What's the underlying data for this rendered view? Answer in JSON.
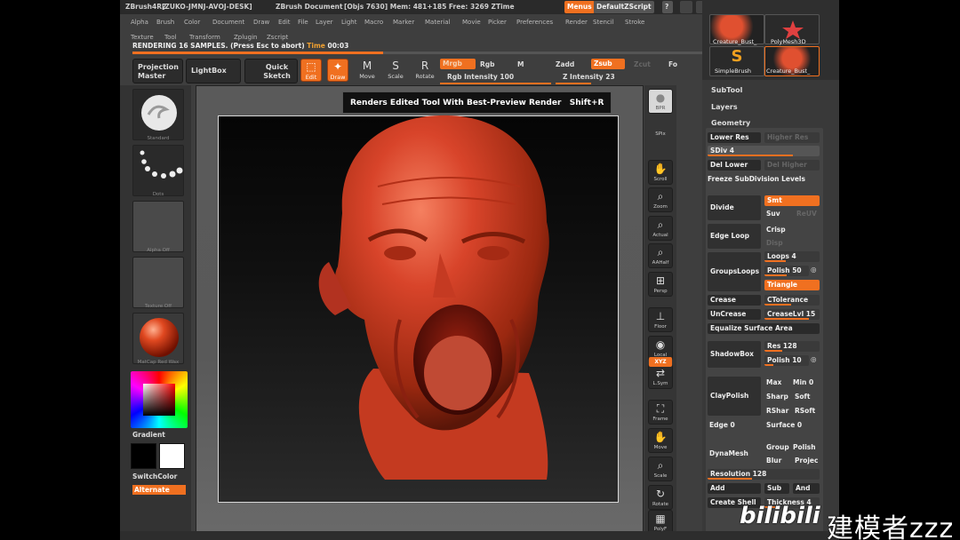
{
  "titlebar": {
    "app": "ZBrush4R2",
    "machine": "[ZUKO-JMNJ-AVOJ-DESK]",
    "document": "ZBrush Document",
    "stats": "[Objs 7630] Mem: 481+185 Free: 3269 ZTime",
    "menus_btn": "Menus",
    "script_btn": "DefaultZScript"
  },
  "menu_row1": [
    "Alpha",
    "Brush",
    "Color",
    "Document",
    "Draw",
    "Edit",
    "File",
    "Layer",
    "Light",
    "Macro",
    "Marker",
    "Material",
    "Movie",
    "Picker",
    "Preferences",
    "Render",
    "Stencil",
    "Stroke"
  ],
  "menu_row2": [
    "Texture",
    "Tool",
    "Transform",
    "Zplugin",
    "Zscript"
  ],
  "status": {
    "text": "RENDERING 16 SAMPLES. (Press Esc to abort)",
    "time_label": "Time",
    "time_value": "00:03",
    "progress": 0.43
  },
  "topshelf": {
    "projection_master": "Projection Master",
    "lightbox": "LightBox",
    "quick_sketch": "Quick Sketch",
    "edit": "Edit",
    "draw": "Draw",
    "move": "Move",
    "scale": "Scale",
    "rotate": "Rotate",
    "mrgb": "Mrgb",
    "rgb": "Rgb",
    "m": "M",
    "rgb_intensity": "Rgb Intensity 100",
    "zadd": "Zadd",
    "zsub": "Zsub",
    "zcut": "Zcut",
    "z_intensity": "Z Intensity 23",
    "focal": "Fo"
  },
  "leftshelf": {
    "brush_label": "Standard",
    "stroke_label": "Dots",
    "alpha_label": "Alpha Off",
    "texture_label": "Texture Off",
    "material_label": "MatCap Red Wax",
    "gradient": "Gradient",
    "switchcolor": "SwitchColor",
    "alternate": "Alternate"
  },
  "tooltip": {
    "text": "Renders Edited Tool With Best-Preview Render",
    "shortcut": "Shift+R"
  },
  "rightshelf": [
    "BPR",
    "SPix",
    "Scroll",
    "Zoom",
    "Actual",
    "AAHalf",
    "Persp",
    "Floor",
    "Local",
    "L.Sym",
    "Frame",
    "Move",
    "Scale",
    "Rotate",
    "PolyF"
  ],
  "xyz_label": "XYZ",
  "tray": {
    "thumbs": [
      "Creature_Bust_",
      "PolyMesh3D",
      "SimpleBrush",
      "Creature_Bust_"
    ],
    "subtool": "SubTool",
    "layers": "Layers",
    "geometry": "Geometry",
    "lower_res": "Lower Res",
    "higher_res": "Higher Res",
    "sdiv": "SDiv 4",
    "del_lower": "Del Lower",
    "del_higher": "Del Higher",
    "freeze": "Freeze SubDivision Levels",
    "divide": "Divide",
    "smt": "Smt",
    "suv": "Suv",
    "reuv": "ReUV",
    "edge_loop": "Edge Loop",
    "crisp": "Crisp",
    "disp": "Disp",
    "groupsloops": "GroupsLoops",
    "loops": "Loops 4",
    "polish": "Polish 50",
    "triangle": "Triangle",
    "crease": "Crease",
    "ctolerance": "CTolerance",
    "uncrease": "UnCrease",
    "creaselvl": "CreaseLvl 15",
    "equalize": "Equalize Surface Area",
    "shadowbox": "ShadowBox",
    "res": "Res 128",
    "polish2": "Polish 10",
    "claypolish": "ClayPolish",
    "max": "Max",
    "min": "Min 0",
    "sharp": "Sharp",
    "soft": "Soft",
    "rshar": "RShar",
    "rsoft": "RSoft",
    "edge": "Edge 0",
    "surface": "Surface 0",
    "dynamesh": "DynaMesh",
    "group": "Group",
    "polish3": "Polish",
    "blur": "Blur",
    "project": "Projec",
    "resolution": "Resolution 128",
    "add": "Add",
    "sub": "Sub",
    "and": "And",
    "create_shell": "Create Shell",
    "thickness": "Thickness 4"
  },
  "watermark": {
    "logo": "bilibili",
    "text": "建模者zzz"
  }
}
